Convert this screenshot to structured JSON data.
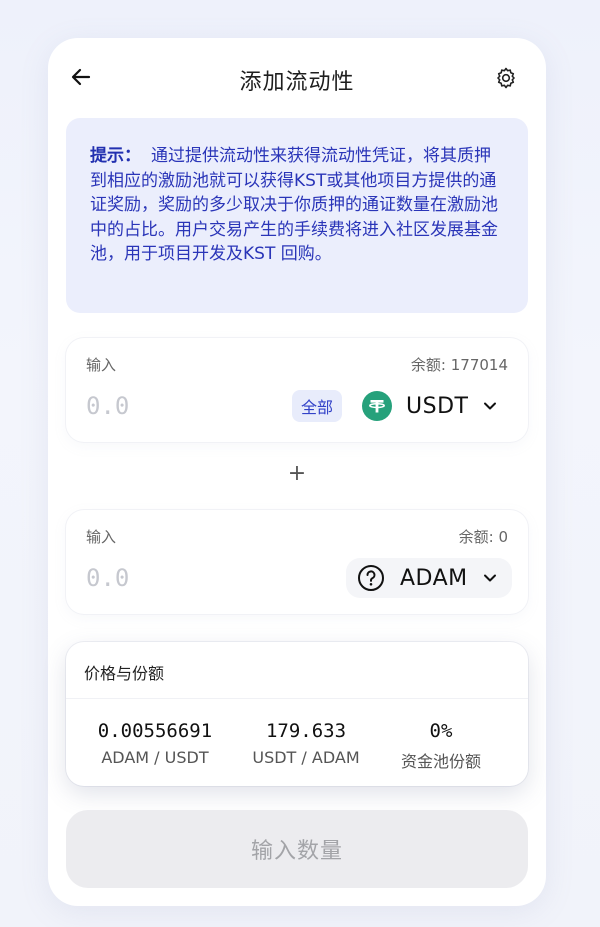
{
  "header": {
    "title": "添加流动性"
  },
  "tip": {
    "label": "提示：",
    "text": "通过提供流动性来获得流动性凭证，将其质押到相应的激励池就可以获得KST或其他项目方提供的通证奖励，奖励的多少取决于你质押的通证数量在激励池中的占比。用户交易产生的手续费将进入社区发展基金池，用于项目开发及KST 回购。"
  },
  "input_a": {
    "label": "输入",
    "balance": "余额: 177014",
    "placeholder": "0.0",
    "max_label": "全部",
    "token": "USDT"
  },
  "plus": "+",
  "input_b": {
    "label": "输入",
    "balance": "余额: 0",
    "placeholder": "0.0",
    "token": "ADAM"
  },
  "price": {
    "title": "价格与份额",
    "stats": [
      {
        "value": "0.00556691",
        "label": "ADAM / USDT"
      },
      {
        "value": "179.633",
        "label": "USDT / ADAM"
      },
      {
        "value": "0%",
        "label": "资金池份额"
      }
    ]
  },
  "submit": {
    "label": "输入数量"
  },
  "colors": {
    "accent": "#2a35b8",
    "tip_bg": "#ebeefc",
    "usdt": "#26a17b",
    "disabled_button": "#ececef"
  },
  "icons": {
    "back": "arrow-left-icon",
    "settings": "gear-icon",
    "usdt": "usdt-token-icon",
    "unknown_token": "question-circle-icon",
    "dropdown": "chevron-down-icon"
  }
}
